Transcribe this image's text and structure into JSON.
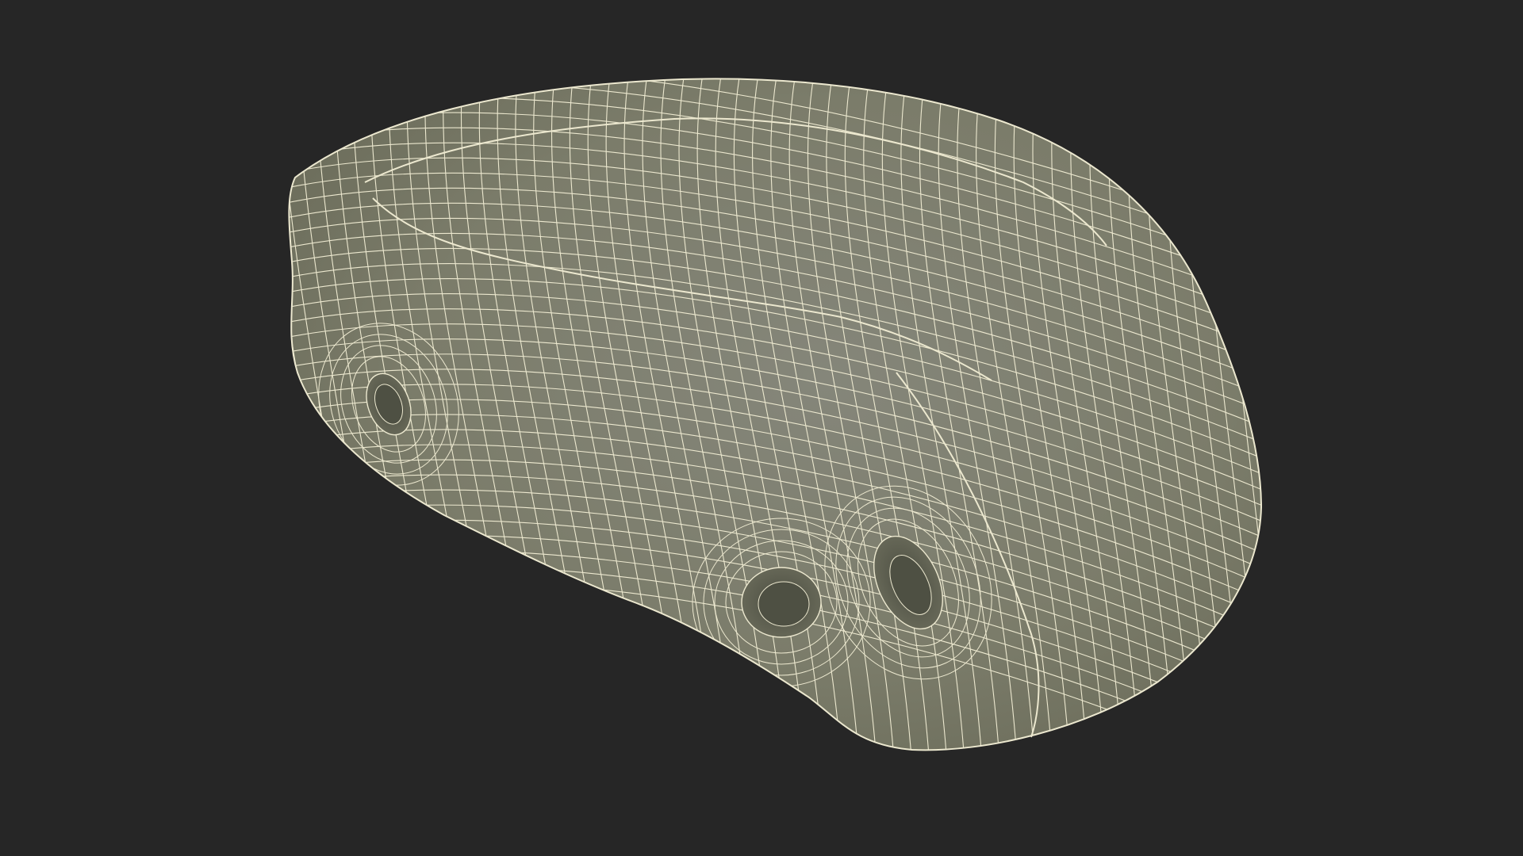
{
  "scene": {
    "subject": "climbing-hold-wireframe",
    "colors": {
      "background": "#262626",
      "surface": "#7b7c6a",
      "surface_shadow": "#666755",
      "surface_light": "#8a8b78",
      "wire": "#ece8cf",
      "hole_inner": "#4e5043"
    },
    "screw_holes": 3
  }
}
